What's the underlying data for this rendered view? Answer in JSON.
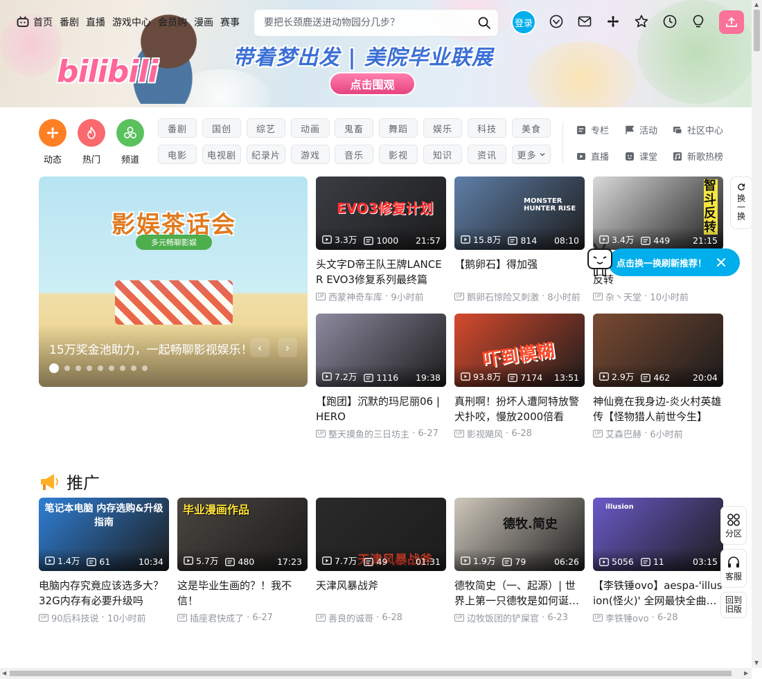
{
  "header": {
    "nav": [
      "首页",
      "番剧",
      "直播",
      "游戏中心",
      "会员购",
      "漫画",
      "赛事"
    ],
    "search_placeholder": "要把长颈鹿送进动物园分几步？",
    "login_label": "登录",
    "logo_text": "bilibili",
    "banner_title": "带着梦出发 | 美院毕业联展",
    "banner_cta": "点击围观",
    "icons": [
      "big-member-icon",
      "message-icon",
      "dynamic-icon",
      "favorites-icon",
      "history-icon",
      "creative-center-icon",
      "upload-icon"
    ]
  },
  "quick": [
    {
      "label": "动态",
      "color": "#ff7f24"
    },
    {
      "label": "热门",
      "color": "#f9696e"
    },
    {
      "label": "频道",
      "color": "#5ac15d"
    }
  ],
  "channels": [
    "番剧",
    "国创",
    "综艺",
    "动画",
    "鬼畜",
    "舞蹈",
    "娱乐",
    "科技",
    "美食",
    "电影",
    "电视剧",
    "纪录片",
    "游戏",
    "音乐",
    "影视",
    "知识",
    "资讯"
  ],
  "more_label": "更多",
  "side_links": [
    "专栏",
    "活动",
    "社区中心",
    "直播",
    "课堂",
    "新歌热榜"
  ],
  "carousel": {
    "poster_title": "影娱茶话会",
    "poster_sub": "多元畅聊影娱",
    "caption": "15万奖金池助力，一起畅聊影视娱乐！",
    "prev": "‹",
    "next": "›",
    "dot_count": 9
  },
  "refresh": {
    "label": "换一换"
  },
  "tooltip": "点击换一换刷新推荐！",
  "videos": [
    {
      "title": "头文字D帝王队王牌LANCER EVO3修复系列最终篇",
      "views": "3.3万",
      "danmaku": "1000",
      "duration": "21:57",
      "author": "西蒙神奇车库",
      "date": "9小时前",
      "thumb_text": "EVO3修复计划",
      "thumb_color": "#3a3d44"
    },
    {
      "title": "【鹅卵石】得加强",
      "views": "15.8万",
      "danmaku": "814",
      "duration": "08:10",
      "author": "鹅卵石惊险又刺激",
      "date": "8小时前",
      "thumb_text": "MONSTER HUNTER RISE",
      "thumb_color": "#5f7fa8"
    },
    {
      "title": "一切玩弄于鼓掌之中！智斗反转",
      "views": "3.4万",
      "danmaku": "449",
      "duration": "21:15",
      "author": "杂丶天堂",
      "date": "10小时前",
      "thumb_text": "智斗反转",
      "thumb_color": "#d9d9d9"
    },
    {
      "title": "【跑团】沉默的玛尼丽06 | HERO",
      "views": "7.2万",
      "danmaku": "1116",
      "duration": "19:38",
      "author": "整天摸鱼的三日坊主",
      "date": "6-27",
      "thumb_text": "",
      "thumb_color": "#8e8aa0"
    },
    {
      "title": "真刑啊！扮坏人遭阿特放警犬扑咬，慢放2000倍看",
      "views": "93.8万",
      "danmaku": "7174",
      "duration": "13:51",
      "author": "影视飓风",
      "date": "6-28",
      "thumb_text": "吓到模糊",
      "thumb_color": "#d64a2e"
    },
    {
      "title": "神仙竟在我身边-炎火村英雄传【怪物猎人前世今生】",
      "views": "2.9万",
      "danmaku": "462",
      "duration": "20:04",
      "author": "艾森巴赫",
      "date": "6小时前",
      "thumb_text": "",
      "thumb_color": "#7a4a32"
    }
  ],
  "promo": {
    "title": "推广",
    "items": [
      {
        "title": "电脑内存究竟应该选多大？32G内存有必要升级吗",
        "views": "1.4万",
        "danmaku": "61",
        "duration": "10:34",
        "author": "90后科技说",
        "date": "10小时前",
        "thumb_text": "笔记本电脑 内存选购&升级指南",
        "thumb_color": "#2f7fd6"
      },
      {
        "title": "这是毕业生画的？！我不信！",
        "views": "5.7万",
        "danmaku": "480",
        "duration": "17:23",
        "author": "插座君快成了",
        "date": "6-27",
        "thumb_text": "毕业漫画作品",
        "thumb_color": "#4a4540"
      },
      {
        "title": "天津风暴战斧",
        "views": "7.7万",
        "danmaku": "49",
        "duration": "01:31",
        "author": "善良的诚哥",
        "date": "6-28",
        "thumb_text": "天津风暴战斧",
        "thumb_color": "#2a2a2a"
      },
      {
        "title": "德牧简史（一、起源）| 世界上第一只德牧是如何诞生的",
        "views": "1.9万",
        "danmaku": "79",
        "duration": "06:26",
        "author": "边牧饭团的铲屎官",
        "date": "6-23",
        "thumb_text": "德牧.简史",
        "thumb_color": "#cfc8bc"
      },
      {
        "title": "【李铁锤ovo】aespa-'illusion(怪火)' 全网最快全曲翻跳",
        "views": "5056",
        "danmaku": "11",
        "duration": "03:15",
        "author": "李铁锤ovo",
        "date": "6-28",
        "thumb_text": "illusion",
        "thumb_color": "#6a5ac8"
      }
    ]
  },
  "side_tools": [
    "分区",
    "客服",
    "回到旧版"
  ]
}
